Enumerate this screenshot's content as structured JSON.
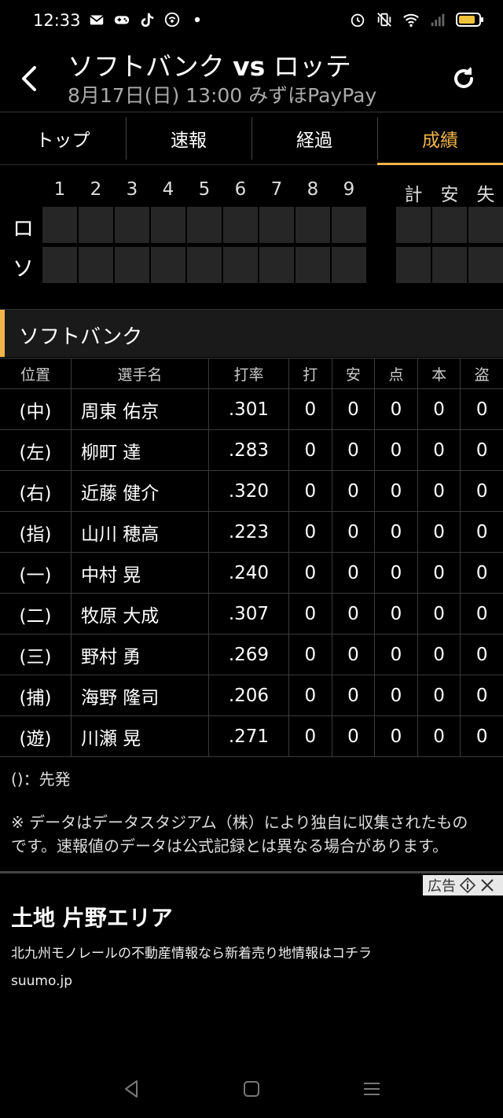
{
  "status_bar": {
    "time": "12:33",
    "left_icons": [
      "mail-icon",
      "gamepad-icon",
      "tiktok-icon",
      "hotspot-icon",
      "dot-icon"
    ],
    "right_icons": [
      "alarm-icon",
      "vibrate-icon",
      "wifi-icon",
      "signal-icon",
      "battery-icon"
    ]
  },
  "header": {
    "title_home": "ソフトバンク",
    "title_vs": "vs",
    "title_away": "ロッテ",
    "subtitle": "8月17日(日) 13:00 みずほPayPay"
  },
  "tabs": [
    {
      "label": "トップ",
      "active": false
    },
    {
      "label": "速報",
      "active": false
    },
    {
      "label": "経過",
      "active": false
    },
    {
      "label": "成績",
      "active": true
    }
  ],
  "scoreboard": {
    "innings": [
      "1",
      "2",
      "3",
      "4",
      "5",
      "6",
      "7",
      "8",
      "9"
    ],
    "totals": [
      "計",
      "安",
      "失"
    ],
    "teams": [
      "ロ",
      "ソ"
    ]
  },
  "team_section": {
    "name": "ソフトバンク"
  },
  "batting_table": {
    "headers": [
      "位置",
      "選手名",
      "打率",
      "打",
      "安",
      "点",
      "本",
      "盗"
    ],
    "rows": [
      {
        "pos": "(中)",
        "name": "周東 佑京",
        "avg": ".301",
        "ab": "0",
        "h": "0",
        "rbi": "0",
        "hr": "0",
        "sb": "0"
      },
      {
        "pos": "(左)",
        "name": "柳町 達",
        "avg": ".283",
        "ab": "0",
        "h": "0",
        "rbi": "0",
        "hr": "0",
        "sb": "0"
      },
      {
        "pos": "(右)",
        "name": "近藤 健介",
        "avg": ".320",
        "ab": "0",
        "h": "0",
        "rbi": "0",
        "hr": "0",
        "sb": "0"
      },
      {
        "pos": "(指)",
        "name": "山川 穂高",
        "avg": ".223",
        "ab": "0",
        "h": "0",
        "rbi": "0",
        "hr": "0",
        "sb": "0"
      },
      {
        "pos": "(一)",
        "name": "中村 晃",
        "avg": ".240",
        "ab": "0",
        "h": "0",
        "rbi": "0",
        "hr": "0",
        "sb": "0"
      },
      {
        "pos": "(二)",
        "name": "牧原 大成",
        "avg": ".307",
        "ab": "0",
        "h": "0",
        "rbi": "0",
        "hr": "0",
        "sb": "0"
      },
      {
        "pos": "(三)",
        "name": "野村 勇",
        "avg": ".269",
        "ab": "0",
        "h": "0",
        "rbi": "0",
        "hr": "0",
        "sb": "0"
      },
      {
        "pos": "(捕)",
        "name": "海野 隆司",
        "avg": ".206",
        "ab": "0",
        "h": "0",
        "rbi": "0",
        "hr": "0",
        "sb": "0"
      },
      {
        "pos": "(遊)",
        "name": "川瀬 晃",
        "avg": ".271",
        "ab": "0",
        "h": "0",
        "rbi": "0",
        "hr": "0",
        "sb": "0"
      }
    ]
  },
  "notes": {
    "starter_legend": "()：先発",
    "disclaimer": "※ データはデータスタジアム（株）により独自に収集されたものです。速報値のデータは公式記録とは異なる場合があります。"
  },
  "ad": {
    "badge": "広告",
    "title": "土地 片野エリア",
    "description": "北九州モノレールの不動産情報なら新着売り地情報はコチラ",
    "url": "suumo.jp"
  },
  "colors": {
    "accent": "#f0b54a",
    "background": "#000000",
    "cell": "#262626"
  }
}
